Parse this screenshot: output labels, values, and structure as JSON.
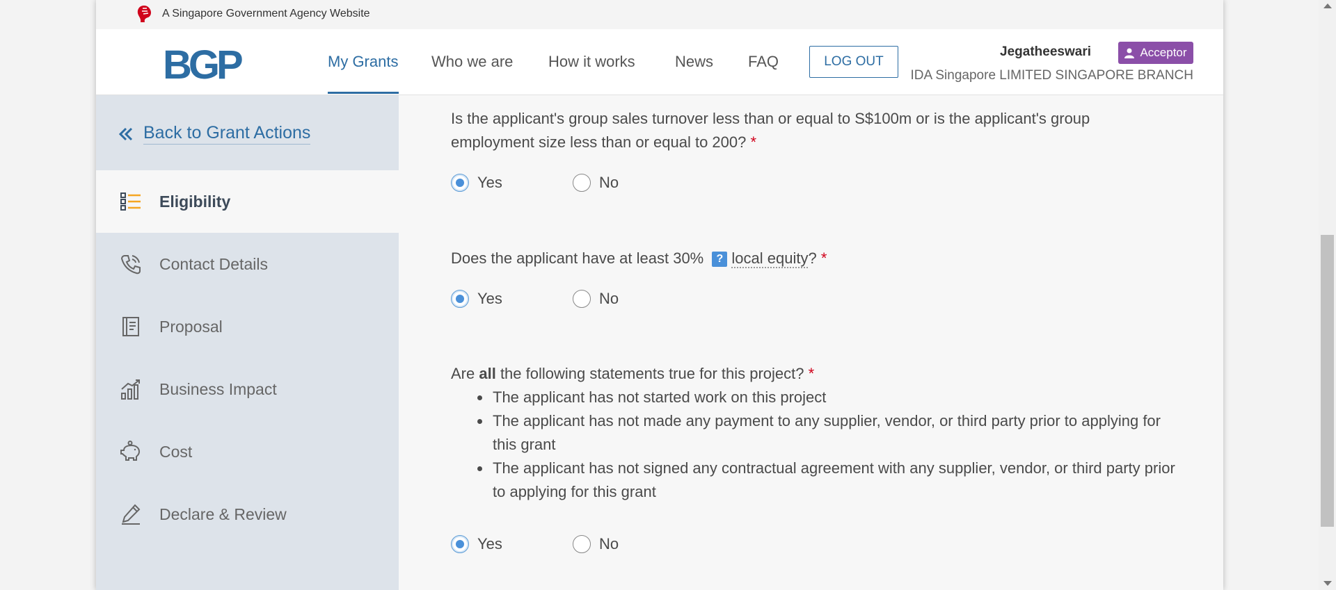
{
  "masthead": {
    "text": "A Singapore Government Agency Website"
  },
  "header": {
    "logo": "BGP",
    "nav": [
      {
        "label": "My Grants",
        "active": true
      },
      {
        "label": "Who we are"
      },
      {
        "label": "How it works"
      },
      {
        "label": "News"
      },
      {
        "label": "FAQ"
      }
    ],
    "logout_label": "LOG OUT",
    "user_name": "Jegatheeswari",
    "role": "Acceptor",
    "org": "IDA Singapore LIMITED SINGAPORE BRANCH"
  },
  "sidebar": {
    "back_label": "Back to Grant Actions",
    "items": [
      {
        "label": "Eligibility",
        "icon": "list-icon",
        "active": true
      },
      {
        "label": "Contact Details",
        "icon": "phone-icon"
      },
      {
        "label": "Proposal",
        "icon": "document-icon"
      },
      {
        "label": "Business Impact",
        "icon": "chart-icon"
      },
      {
        "label": "Cost",
        "icon": "piggy-bank-icon"
      },
      {
        "label": "Declare & Review",
        "icon": "pen-icon"
      }
    ]
  },
  "questions": {
    "q1": {
      "line1": "Is the applicant's group sales turnover less than or equal to S$100m or is the applicant's group",
      "line2": "employment size less than or equal to 200?",
      "required": "*",
      "yes": "Yes",
      "no": "No",
      "selected": "Yes"
    },
    "q2": {
      "prefix": "Does the applicant have at least 30%",
      "help": "?",
      "term": "local equity",
      "suffix": "?",
      "required": "*",
      "yes": "Yes",
      "no": "No",
      "selected": "Yes"
    },
    "q3": {
      "pre": "Are ",
      "bold": "all",
      "post": " the following statements true for this project?",
      "required": "*",
      "statements": [
        "The applicant has not started work on this project",
        "The applicant has not made any payment to any supplier, vendor, or third party prior to applying for this grant",
        "The applicant has not signed any contractual agreement with any supplier, vendor, or third party prior to applying for this grant"
      ],
      "yes": "Yes",
      "no": "No",
      "selected": "Yes"
    }
  },
  "colors": {
    "brand": "#2d6da3",
    "badge": "#8b4fa8",
    "sidebar_bg": "#dde3ea",
    "required": "#d0021b"
  }
}
